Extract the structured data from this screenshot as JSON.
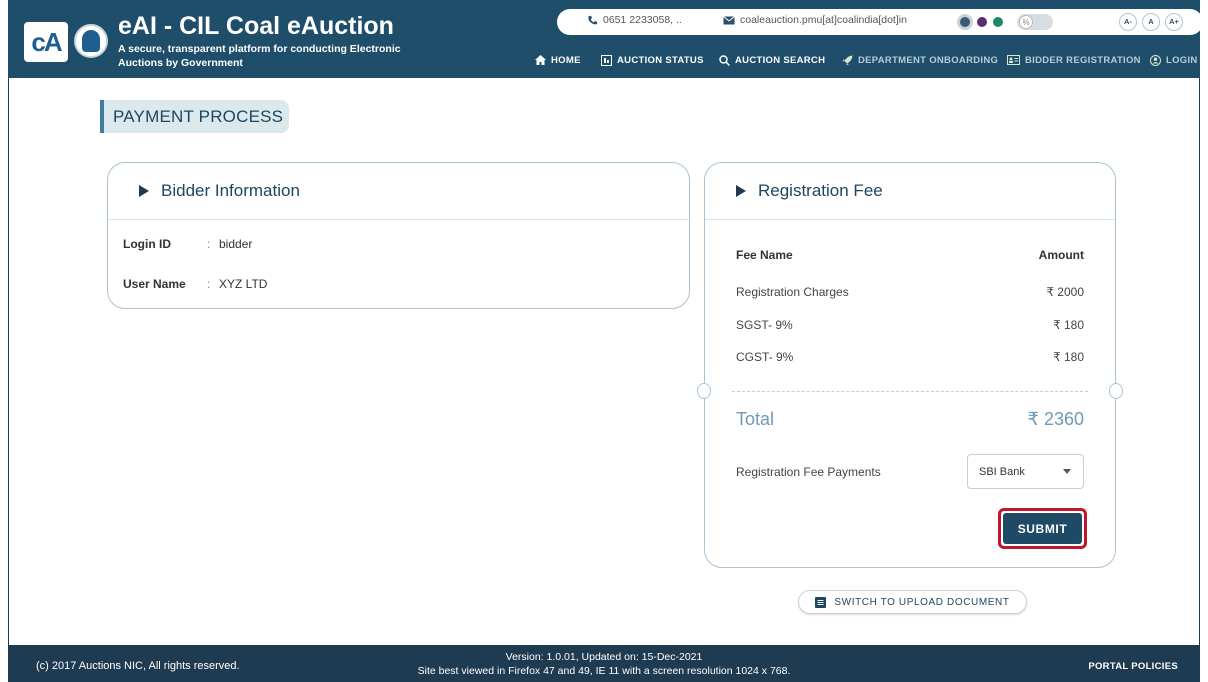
{
  "header": {
    "logo_text": "cA",
    "title": "eAI - CIL Coal eAuction",
    "subtitle": "A secure, transparent platform for conducting Electronic Auctions by Government",
    "phone": "0651 2233058, ..",
    "email": "coaleauction.pmu[at]coalindia[dot]in",
    "font_size_buttons": [
      "A-",
      "A",
      "A+"
    ],
    "theme_dots": [
      "#3d5a73",
      "#5b2d6e",
      "#1e8a63"
    ]
  },
  "nav": {
    "items": [
      {
        "label": "HOME",
        "icon": "home-icon"
      },
      {
        "label": "AUCTION STATUS",
        "icon": "status-icon"
      },
      {
        "label": "AUCTION SEARCH",
        "icon": "search-icon"
      },
      {
        "label": "DEPARTMENT ONBOARDING",
        "icon": "rocket-icon"
      },
      {
        "label": "BIDDER REGISTRATION",
        "icon": "id-card-icon"
      },
      {
        "label": "LOGIN",
        "icon": "user-icon"
      }
    ]
  },
  "page": {
    "section_title": "PAYMENT PROCESS"
  },
  "bidder_info": {
    "title": "Bidder Information",
    "rows": [
      {
        "key": "Login ID",
        "value": "bidder"
      },
      {
        "key": "User Name",
        "value": "XYZ LTD"
      }
    ]
  },
  "registration_fee": {
    "title": "Registration Fee",
    "col_name": "Fee Name",
    "col_amount": "Amount",
    "fees": [
      {
        "name": "Registration Charges",
        "amount": "₹ 2000"
      },
      {
        "name": "SGST- 9%",
        "amount": "₹ 180"
      },
      {
        "name": "CGST- 9%",
        "amount": "₹ 180"
      }
    ],
    "total_label": "Total",
    "total_value": "₹ 2360",
    "payment_label": "Registration Fee Payments",
    "payment_selected": "SBI Bank",
    "submit_label": "SUBMIT"
  },
  "switch_button": "SWITCH TO UPLOAD DOCUMENT",
  "footer": {
    "copyright": "(c) 2017 Auctions NIC, All rights reserved.",
    "version": "Version: 1.0.01, Updated on: 15-Dec-2021",
    "browser_note": "Site best viewed in Firefox 47 and 49, IE 11 with a screen resolution 1024 x 768.",
    "policies": "PORTAL POLICIES"
  }
}
